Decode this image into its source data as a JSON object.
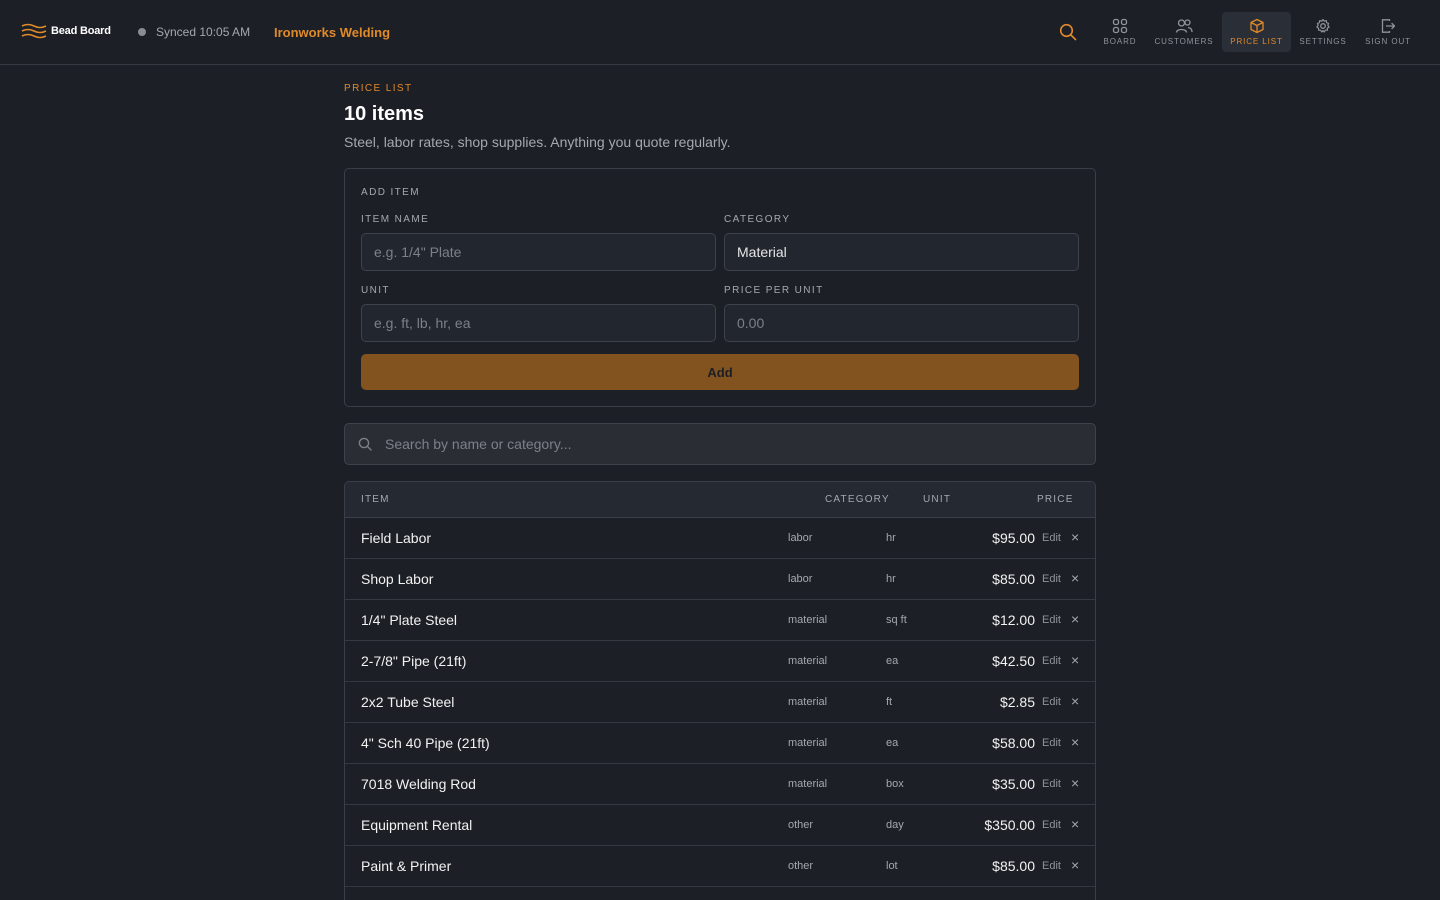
{
  "header": {
    "brand": "Bead Board",
    "sync_status": "Synced 10:05 AM",
    "shop_name": "Ironworks Welding",
    "nav": [
      {
        "id": "board",
        "label": "BOARD",
        "icon": "grid-icon"
      },
      {
        "id": "customers",
        "label": "CUSTOMERS",
        "icon": "users-icon"
      },
      {
        "id": "price-list",
        "label": "PRICE LIST",
        "icon": "box-icon",
        "active": true
      },
      {
        "id": "settings",
        "label": "SETTINGS",
        "icon": "gear-icon"
      },
      {
        "id": "sign-out",
        "label": "SIGN OUT",
        "icon": "sign-out-icon"
      }
    ]
  },
  "page": {
    "eyebrow": "PRICE LIST",
    "title": "10 items",
    "subtitle": "Steel, labor rates, shop supplies. Anything you quote regularly."
  },
  "add_item": {
    "title": "ADD ITEM",
    "name_label": "ITEM NAME",
    "name_placeholder": "e.g. 1/4\" Plate",
    "category_label": "CATEGORY",
    "category_value": "Material",
    "unit_label": "UNIT",
    "unit_placeholder": "e.g. ft, lb, hr, ea",
    "price_label": "PRICE PER UNIT",
    "price_placeholder": "0.00",
    "add_label": "Add"
  },
  "search": {
    "placeholder": "Search by name or category..."
  },
  "table": {
    "headers": {
      "item": "ITEM",
      "category": "CATEGORY",
      "unit": "UNIT",
      "price": "PRICE"
    },
    "edit_label": "Edit",
    "delete_label": "×",
    "rows": [
      {
        "name": "Field Labor",
        "category": "labor",
        "unit": "hr",
        "price": "$95.00"
      },
      {
        "name": "Shop Labor",
        "category": "labor",
        "unit": "hr",
        "price": "$85.00"
      },
      {
        "name": "1/4\" Plate Steel",
        "category": "material",
        "unit": "sq ft",
        "price": "$12.00"
      },
      {
        "name": "2-7/8\" Pipe (21ft)",
        "category": "material",
        "unit": "ea",
        "price": "$42.50"
      },
      {
        "name": "2x2 Tube Steel",
        "category": "material",
        "unit": "ft",
        "price": "$2.85"
      },
      {
        "name": "4\" Sch 40 Pipe (21ft)",
        "category": "material",
        "unit": "ea",
        "price": "$58.00"
      },
      {
        "name": "7018 Welding Rod",
        "category": "material",
        "unit": "box",
        "price": "$35.00"
      },
      {
        "name": "Equipment Rental",
        "category": "other",
        "unit": "day",
        "price": "$350.00"
      },
      {
        "name": "Paint & Primer",
        "category": "other",
        "unit": "lot",
        "price": "$85.00"
      }
    ]
  },
  "colors": {
    "accent": "#e08a2a",
    "button": "#82531f",
    "background": "#1c1f26"
  }
}
